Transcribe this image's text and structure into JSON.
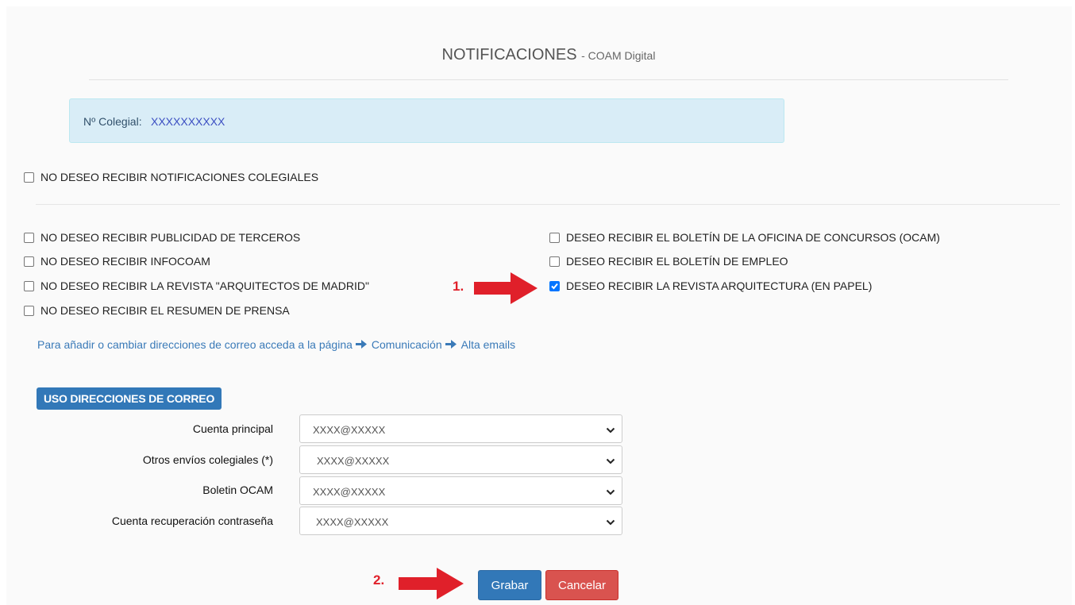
{
  "header": {
    "title": "NOTIFICACIONES",
    "subtitle": "- COAM Digital"
  },
  "member": {
    "label": "Nº Colegial:",
    "value": "XXXXXXXXXX"
  },
  "global_option": {
    "label": "NO DESEO RECIBIR NOTIFICACIONES COLEGIALES",
    "checked": false
  },
  "options_left": [
    {
      "label": "NO DESEO RECIBIR PUBLICIDAD DE TERCEROS",
      "checked": false
    },
    {
      "label": "NO DESEO RECIBIR INFOCOAM",
      "checked": false
    },
    {
      "label": "NO DESEO RECIBIR LA REVISTA \"ARQUITECTOS DE MADRID\"",
      "checked": false
    },
    {
      "label": "NO DESEO RECIBIR EL RESUMEN DE PRENSA",
      "checked": false
    }
  ],
  "options_right": [
    {
      "label": "DESEO RECIBIR EL BOLETÍN DE LA OFICINA DE CONCURSOS (OCAM)",
      "checked": false
    },
    {
      "label": "DESEO RECIBIR EL BOLETÍN DE EMPLEO",
      "checked": false
    },
    {
      "label": "DESEO RECIBIR LA REVISTA ARQUITECTURA (EN PAPEL)",
      "checked": true
    }
  ],
  "help_link": {
    "text": "Para añadir o cambiar direcciones de correo acceda a la página",
    "link1": "Comunicación",
    "link2": "Alta emails"
  },
  "email_section": {
    "title": "USO DIRECCIONES DE CORREO",
    "rows": [
      {
        "label": "Cuenta principal",
        "value": "XXXX@XXXXX"
      },
      {
        "label": "Otros envíos colegiales (*)",
        "value": "XXXX@XXXXX"
      },
      {
        "label": "Boletin OCAM",
        "value": "XXXX@XXXXX"
      },
      {
        "label": "Cuenta recuperación contraseña",
        "value": "XXXX@XXXXX"
      }
    ]
  },
  "buttons": {
    "save": "Grabar",
    "cancel": "Cancelar"
  },
  "annotations": {
    "step1": "1.",
    "step2": "2."
  },
  "colors": {
    "primary": "#3278b8",
    "danger": "#d9534f",
    "info_bg": "#d9edf7",
    "annotation": "#e0202a",
    "checkbox_checked": "#0075ff"
  }
}
